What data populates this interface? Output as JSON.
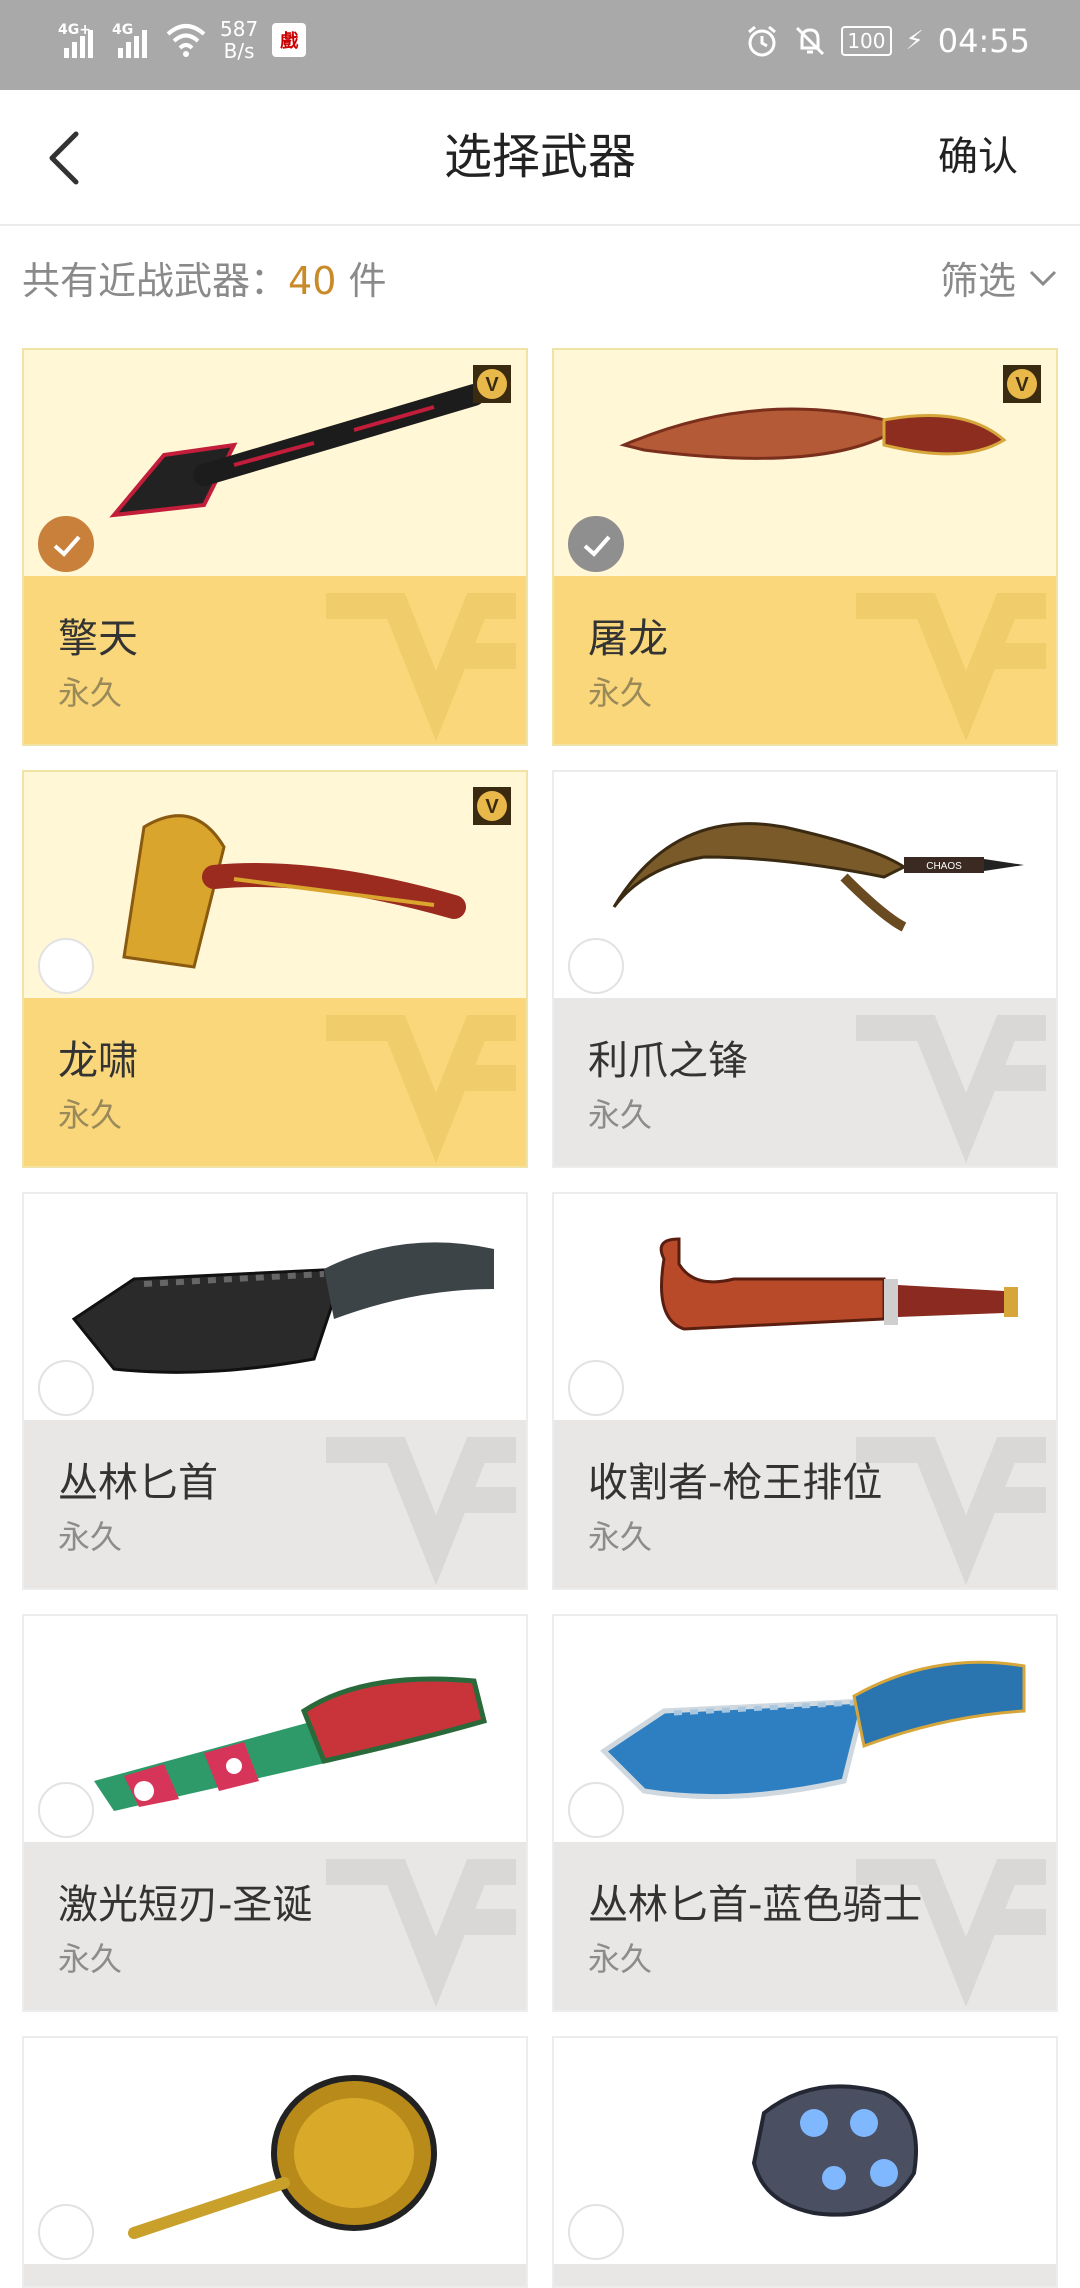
{
  "status_bar": {
    "net_tag_1": "4G+",
    "net_tag_2": "4G",
    "speed_value": "587",
    "speed_unit": "B/s",
    "app_badge": "戲",
    "battery": "100",
    "time": "04:55"
  },
  "header": {
    "title": "选择武器",
    "confirm_label": "确认"
  },
  "summary": {
    "prefix": "共有近战武器：",
    "count": "40",
    "suffix": " 件",
    "filter_label": "筛选"
  },
  "colors": {
    "premium_bottom": "#f9d77a",
    "premium_top": "#fff7d6",
    "normal_bottom": "#e9e7e5",
    "accent": "#c98a2a",
    "check_selected": "#c8803a"
  },
  "items": [
    {
      "name": "擎天",
      "duration": "永久",
      "premium": true,
      "vip_icon": "v-badge-icon",
      "state": "selected",
      "weapon_icon": "shovel-axe-icon"
    },
    {
      "name": "屠龙",
      "duration": "永久",
      "premium": true,
      "vip_icon": "v-badge-icon",
      "state": "disabled-selected",
      "weapon_icon": "dragon-blade-icon"
    },
    {
      "name": "龙啸",
      "duration": "永久",
      "premium": true,
      "vip_icon": "v-badge-icon",
      "state": "unselected",
      "weapon_icon": "dragon-axe-icon"
    },
    {
      "name": "利爪之锋",
      "duration": "永久",
      "premium": false,
      "state": "unselected",
      "weapon_icon": "claw-blade-icon",
      "weapon_text": "CHAOS"
    },
    {
      "name": "丛林匕首",
      "duration": "永久",
      "premium": false,
      "state": "unselected",
      "weapon_icon": "jungle-knife-icon"
    },
    {
      "name": "收割者-枪王排位",
      "duration": "永久",
      "premium": false,
      "state": "unselected",
      "weapon_icon": "hook-knife-icon"
    },
    {
      "name": "激光短刃-圣诞",
      "duration": "永久",
      "premium": false,
      "state": "unselected",
      "weapon_icon": "christmas-blade-icon"
    },
    {
      "name": "丛林匕首-蓝色骑士",
      "duration": "永久",
      "premium": false,
      "state": "unselected",
      "weapon_icon": "blue-knife-icon"
    },
    {
      "name": "",
      "duration": "",
      "premium": false,
      "state": "unselected",
      "weapon_icon": "frying-pan-icon"
    },
    {
      "name": "",
      "duration": "",
      "premium": false,
      "state": "unselected",
      "weapon_icon": "power-fist-icon"
    }
  ]
}
